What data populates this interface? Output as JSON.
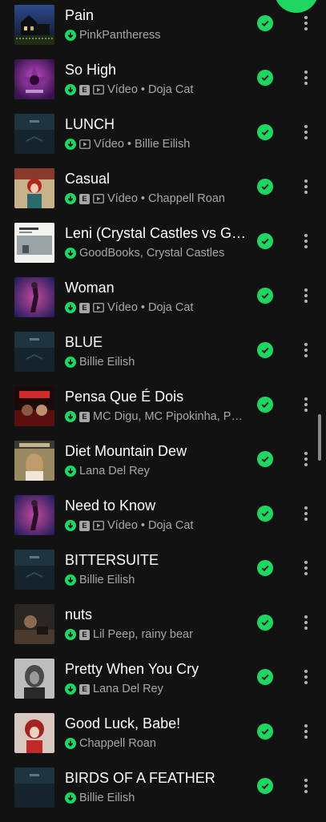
{
  "colors": {
    "background": "#121212",
    "accent": "#1ed760",
    "primary_text": "#ffffff",
    "secondary_text": "#a7a7a7"
  },
  "icons": {
    "downloaded": "download-arrow-circle-icon",
    "explicit": "explicit-badge-icon",
    "video": "video-play-icon",
    "saved": "check-circle-icon",
    "more": "more-vertical-icon"
  },
  "explicit_label": "E",
  "tracks": [
    {
      "title": "Pain",
      "meta": "PinkPantheress",
      "explicit": false,
      "video": false
    },
    {
      "title": "So High",
      "meta": "Vídeo • Doja Cat",
      "explicit": true,
      "video": true
    },
    {
      "title": "LUNCH",
      "meta": "Vídeo • Billie Eilish",
      "explicit": false,
      "video": true
    },
    {
      "title": "Casual",
      "meta": "Vídeo • Chappell Roan",
      "explicit": true,
      "video": true
    },
    {
      "title": "Leni (Crystal Castles vs G…",
      "meta": "GoodBooks, Crystal Castles",
      "explicit": false,
      "video": false
    },
    {
      "title": "Woman",
      "meta": "Vídeo • Doja Cat",
      "explicit": true,
      "video": true
    },
    {
      "title": "BLUE",
      "meta": "Billie Eilish",
      "explicit": false,
      "video": false
    },
    {
      "title": "Pensa Que É Dois",
      "meta": "MC Digu, MC Pipokinha, P…",
      "explicit": true,
      "video": false
    },
    {
      "title": "Diet Mountain Dew",
      "meta": "Lana Del Rey",
      "explicit": false,
      "video": false
    },
    {
      "title": "Need to Know",
      "meta": "Vídeo • Doja Cat",
      "explicit": true,
      "video": true
    },
    {
      "title": "BITTERSUITE",
      "meta": "Billie Eilish",
      "explicit": false,
      "video": false
    },
    {
      "title": "nuts",
      "meta": "Lil Peep, rainy bear",
      "explicit": true,
      "video": false
    },
    {
      "title": "Pretty When You Cry",
      "meta": "Lana Del Rey",
      "explicit": true,
      "video": false
    },
    {
      "title": "Good Luck, Babe!",
      "meta": "Chappell Roan",
      "explicit": false,
      "video": false
    },
    {
      "title": "BIRDS OF A FEATHER",
      "meta": "Billie Eilish",
      "explicit": false,
      "video": false
    }
  ]
}
